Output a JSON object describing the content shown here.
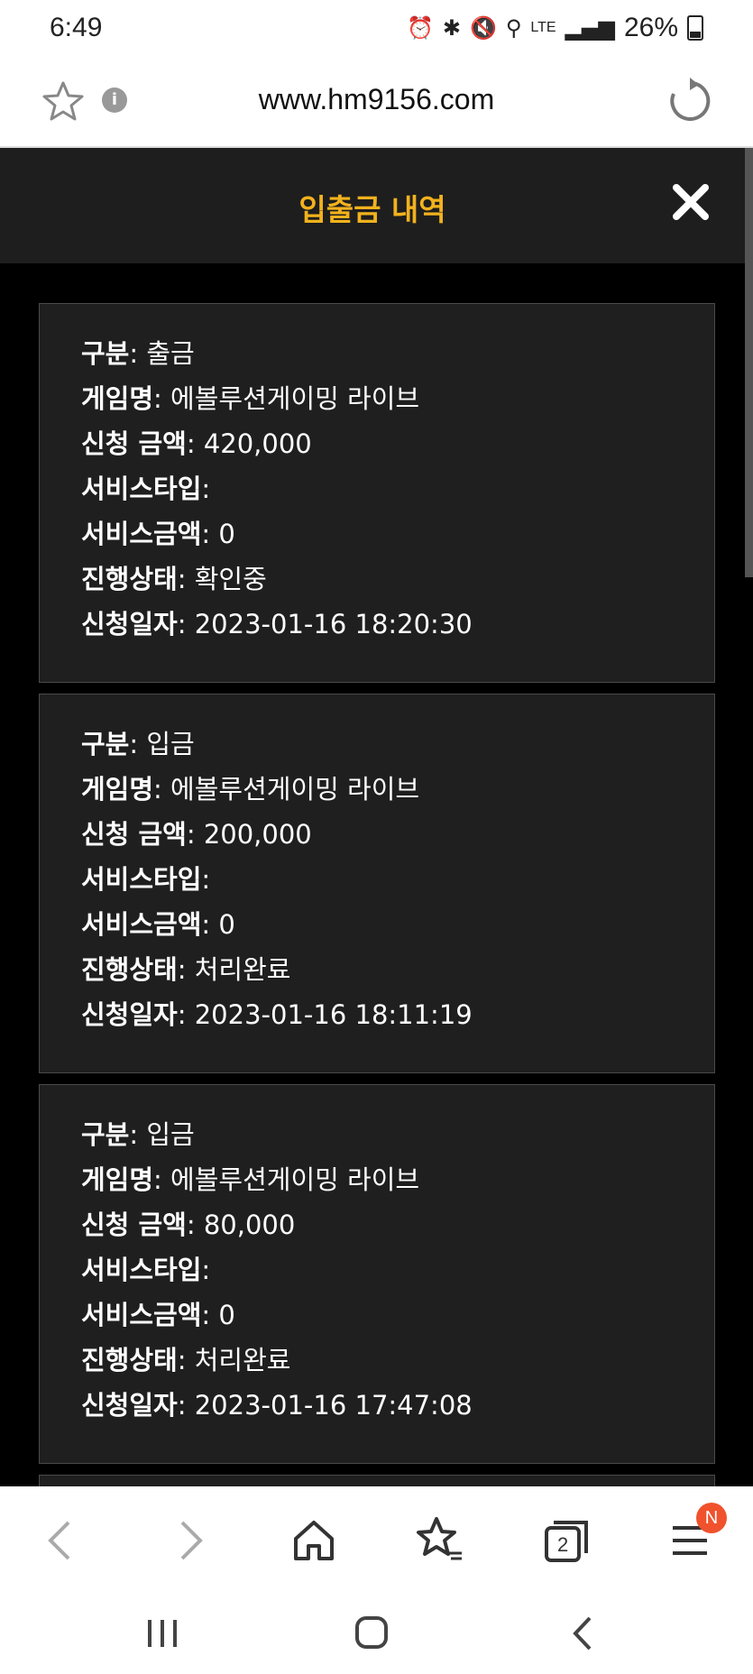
{
  "status_bar": {
    "time": "6:49",
    "battery_percent": "26%",
    "network": "LTE"
  },
  "browser": {
    "url": "www.hm9156.com",
    "tab_count": "2",
    "menu_badge": "N"
  },
  "modal": {
    "title": "입출금 내역"
  },
  "labels": {
    "type": "구분",
    "game": "게임명",
    "amount": "신청 금액",
    "service_type": "서비스타입",
    "service_amount": "서비스금액",
    "status": "진행상태",
    "date": "신청일자"
  },
  "records": [
    {
      "type": "출금",
      "game": "에볼루션게이밍 라이브",
      "amount": "420,000",
      "service_type": "",
      "service_amount": "0",
      "status": "확인중",
      "date": "2023-01-16 18:20:30"
    },
    {
      "type": "입금",
      "game": "에볼루션게이밍 라이브",
      "amount": "200,000",
      "service_type": "",
      "service_amount": "0",
      "status": "처리완료",
      "date": "2023-01-16 18:11:19"
    },
    {
      "type": "입금",
      "game": "에볼루션게이밍 라이브",
      "amount": "80,000",
      "service_type": "",
      "service_amount": "0",
      "status": "처리완료",
      "date": "2023-01-16 17:47:08"
    }
  ],
  "colors": {
    "accent": "#f2b21d",
    "modal_bg": "#1e1e1e",
    "card_bg": "#1f1f1f",
    "page_bg": "#000000",
    "badge": "#f0522d"
  }
}
